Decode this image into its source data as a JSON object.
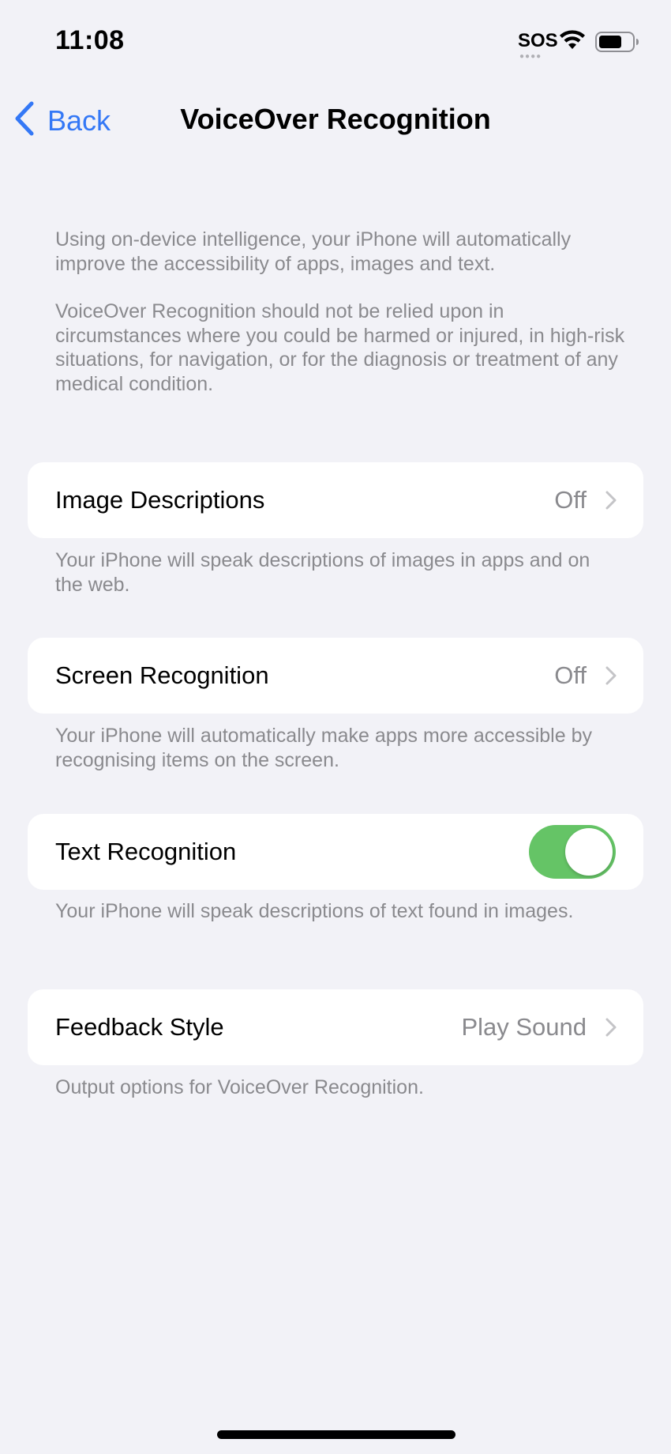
{
  "status_bar": {
    "time": "11:08",
    "carrier": "SOS",
    "icons": [
      "wifi-icon",
      "battery-icon"
    ]
  },
  "nav": {
    "back_label": "Back",
    "title": "VoiceOver Recognition"
  },
  "intro": {
    "paragraph_1": "Using on-device intelligence, your iPhone will automatically improve the accessibility of apps, images and text.",
    "paragraph_2": "VoiceOver Recognition should not be relied upon in circumstances where you could be harmed or injured, in high-risk situations, for navigation, or for the diagnosis or treatment of any medical condition."
  },
  "settings": [
    {
      "label": "Image Descriptions",
      "value": "Off",
      "footer": "Your iPhone will speak descriptions of images in apps and on the web."
    },
    {
      "label": "Screen Recognition",
      "value": "Off",
      "footer": "Your iPhone will automatically make apps more accessible by recognising items on the screen."
    },
    {
      "label": "Text Recognition",
      "toggle_on": true,
      "footer": "Your iPhone will speak descriptions of text found in images."
    },
    {
      "label": "Feedback Style",
      "value": "Play Sound",
      "footer": "Output options for VoiceOver Recognition."
    }
  ],
  "colors": {
    "background": "#f2f2f7",
    "accent": "#3478f6",
    "toggle_on": "#65c466",
    "secondary_text": "#8a8a8e"
  }
}
